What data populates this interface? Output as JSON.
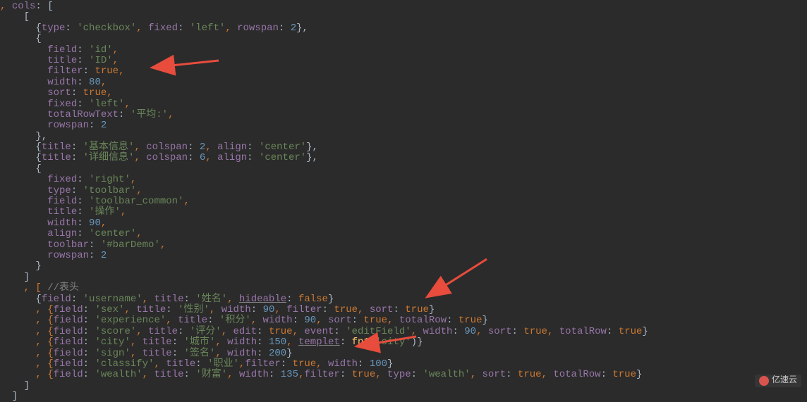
{
  "watermark": {
    "text": "亿速云"
  },
  "code": {
    "line1_a": ", ",
    "line1_b": "cols",
    "line1_c": ": [",
    "line2_a": "    [",
    "line3_a": "      {",
    "line3_b": "type",
    "line3_c": ": ",
    "line3_d": "'checkbox'",
    "line3_e": ", ",
    "line3_f": "fixed",
    "line3_g": ": ",
    "line3_h": "'left'",
    "line3_i": ", ",
    "line3_j": "rowspan",
    "line3_k": ": ",
    "line3_l": "2",
    "line3_m": "},",
    "line4_a": "      {",
    "line5_a": "        ",
    "line5_b": "field",
    "line5_c": ": ",
    "line5_d": "'id'",
    "line5_e": ",",
    "line6_a": "        ",
    "line6_b": "title",
    "line6_c": ": ",
    "line6_d": "'ID'",
    "line6_e": ",",
    "line7_a": "        ",
    "line7_b": "filter",
    "line7_c": ": ",
    "line7_d": "true",
    "line7_e": ",",
    "line8_a": "        ",
    "line8_b": "width",
    "line8_c": ": ",
    "line8_d": "80",
    "line8_e": ",",
    "line9_a": "        ",
    "line9_b": "sort",
    "line9_c": ": ",
    "line9_d": "true",
    "line9_e": ",",
    "line10_a": "        ",
    "line10_b": "fixed",
    "line10_c": ": ",
    "line10_d": "'left'",
    "line10_e": ",",
    "line11_a": "        ",
    "line11_b": "totalRowText",
    "line11_c": ": ",
    "line11_d": "'平均:'",
    "line11_e": ",",
    "line12_a": "        ",
    "line12_b": "rowspan",
    "line12_c": ": ",
    "line12_d": "2",
    "line13_a": "      },",
    "line14_a": "      {",
    "line14_b": "title",
    "line14_c": ": ",
    "line14_d": "'基本信息'",
    "line14_e": ", ",
    "line14_f": "colspan",
    "line14_g": ": ",
    "line14_h": "2",
    "line14_i": ", ",
    "line14_j": "align",
    "line14_k": ": ",
    "line14_l": "'center'",
    "line14_m": "},",
    "line15_a": "      {",
    "line15_b": "title",
    "line15_c": ": ",
    "line15_d": "'详细信息'",
    "line15_e": ", ",
    "line15_f": "colspan",
    "line15_g": ": ",
    "line15_h": "6",
    "line15_i": ", ",
    "line15_j": "align",
    "line15_k": ": ",
    "line15_l": "'center'",
    "line15_m": "},",
    "line16_a": "      {",
    "line17_a": "        ",
    "line17_b": "fixed",
    "line17_c": ": ",
    "line17_d": "'right'",
    "line17_e": ",",
    "line18_a": "        ",
    "line18_b": "type",
    "line18_c": ": ",
    "line18_d": "'toolbar'",
    "line18_e": ",",
    "line19_a": "        ",
    "line19_b": "field",
    "line19_c": ": ",
    "line19_d": "'toolbar_common'",
    "line19_e": ",",
    "line20_a": "        ",
    "line20_b": "title",
    "line20_c": ": ",
    "line20_d": "'操作'",
    "line20_e": ",",
    "line21_a": "        ",
    "line21_b": "width",
    "line21_c": ": ",
    "line21_d": "90",
    "line21_e": ",",
    "line22_a": "        ",
    "line22_b": "align",
    "line22_c": ": ",
    "line22_d": "'center'",
    "line22_e": ",",
    "line23_a": "        ",
    "line23_b": "toolbar",
    "line23_c": ": ",
    "line23_d": "'#barDemo'",
    "line23_e": ",",
    "line24_a": "        ",
    "line24_b": "rowspan",
    "line24_c": ": ",
    "line24_d": "2",
    "line25_a": "      }",
    "line26_a": "    ]",
    "line27_a": "    , [ ",
    "line27_b": "//表头",
    "line28_a": "      {",
    "line28_b": "field",
    "line28_c": ": ",
    "line28_d": "'username'",
    "line28_e": ", ",
    "line28_f": "title",
    "line28_g": ": ",
    "line28_h": "'姓名'",
    "line28_i": ", ",
    "line28_j": "hideable",
    "line28_k": ": ",
    "line28_l": "false",
    "line28_m": "}",
    "line29_a": "      , {",
    "line29_b": "field",
    "line29_c": ": ",
    "line29_d": "'sex'",
    "line29_e": ", ",
    "line29_f": "title",
    "line29_g": ": ",
    "line29_h": "'性别'",
    "line29_i": ", ",
    "line29_j": "width",
    "line29_k": ": ",
    "line29_l": "90",
    "line29_m": ", ",
    "line29_n": "filter",
    "line29_o": ": ",
    "line29_p": "true",
    "line29_q": ", ",
    "line29_r": "sort",
    "line29_s": ": ",
    "line29_t": "true",
    "line29_u": "}",
    "line30_a": "      , {",
    "line30_b": "field",
    "line30_c": ": ",
    "line30_d": "'experience'",
    "line30_e": ", ",
    "line30_f": "title",
    "line30_g": ": ",
    "line30_h": "'积分'",
    "line30_i": ", ",
    "line30_j": "width",
    "line30_k": ": ",
    "line30_l": "90",
    "line30_m": ", ",
    "line30_n": "sort",
    "line30_o": ": ",
    "line30_p": "true",
    "line30_q": ", ",
    "line30_r": "totalRow",
    "line30_s": ": ",
    "line30_t": "true",
    "line30_u": "}",
    "line31_a": "      , {",
    "line31_b": "field",
    "line31_c": ": ",
    "line31_d": "'score'",
    "line31_e": ", ",
    "line31_f": "title",
    "line31_g": ": ",
    "line31_h": "'评分'",
    "line31_i": ", ",
    "line31_j": "edit",
    "line31_k": ": ",
    "line31_l": "true",
    "line31_m": ", ",
    "line31_n": "event",
    "line31_o": ": ",
    "line31_p": "'editField'",
    "line31_q": ", ",
    "line31_r": "width",
    "line31_s": ": ",
    "line31_t": "90",
    "line31_u": ", ",
    "line31_v": "sort",
    "line31_w": ": ",
    "line31_x": "true",
    "line31_y": ", ",
    "line31_z": "totalRow",
    "line31_aa": ": ",
    "line31_ab": "true",
    "line31_ac": "}",
    "line32_a": "      , {",
    "line32_b": "field",
    "line32_c": ": ",
    "line32_d": "'city'",
    "line32_e": ", ",
    "line32_f": "title",
    "line32_g": ": ",
    "line32_h": "'城市'",
    "line32_i": ", ",
    "line32_j": "width",
    "line32_k": ": ",
    "line32_l": "150",
    "line32_m": ", ",
    "line32_n": "templet",
    "line32_o": ": ",
    "line32_p": "fn1",
    "line32_q": "(",
    "line32_r": "'city'",
    "line32_s": ")}",
    "line33_a": "      , {",
    "line33_b": "field",
    "line33_c": ": ",
    "line33_d": "'sign'",
    "line33_e": ", ",
    "line33_f": "title",
    "line33_g": ": ",
    "line33_h": "'签名'",
    "line33_i": ", ",
    "line33_j": "width",
    "line33_k": ": ",
    "line33_l": "200",
    "line33_m": "}",
    "line34_a": "      , {",
    "line34_b": "field",
    "line34_c": ": ",
    "line34_d": "'classify'",
    "line34_e": ", ",
    "line34_f": "title",
    "line34_g": ": ",
    "line34_h": "'职业'",
    "line34_i": ",",
    "line34_j": "filter",
    "line34_k": ": ",
    "line34_l": "true",
    "line34_m": ", ",
    "line34_n": "width",
    "line34_o": ": ",
    "line34_p": "100",
    "line34_q": "}",
    "line35_a": "      , {",
    "line35_b": "field",
    "line35_c": ": ",
    "line35_d": "'wealth'",
    "line35_e": ", ",
    "line35_f": "title",
    "line35_g": ": ",
    "line35_h": "'财富'",
    "line35_i": ", ",
    "line35_j": "width",
    "line35_k": ": ",
    "line35_l": "135",
    "line35_m": ",",
    "line35_n": "filter",
    "line35_o": ": ",
    "line35_p": "true",
    "line35_q": ", ",
    "line35_r": "type",
    "line35_s": ": ",
    "line35_t": "'wealth'",
    "line35_u": ", ",
    "line35_v": "sort",
    "line35_w": ": ",
    "line35_x": "true",
    "line35_y": ", ",
    "line35_z": "totalRow",
    "line35_aa": ": ",
    "line35_ab": "true",
    "line35_ac": "}",
    "line36_a": "    ]",
    "line37_a": "  ]"
  }
}
